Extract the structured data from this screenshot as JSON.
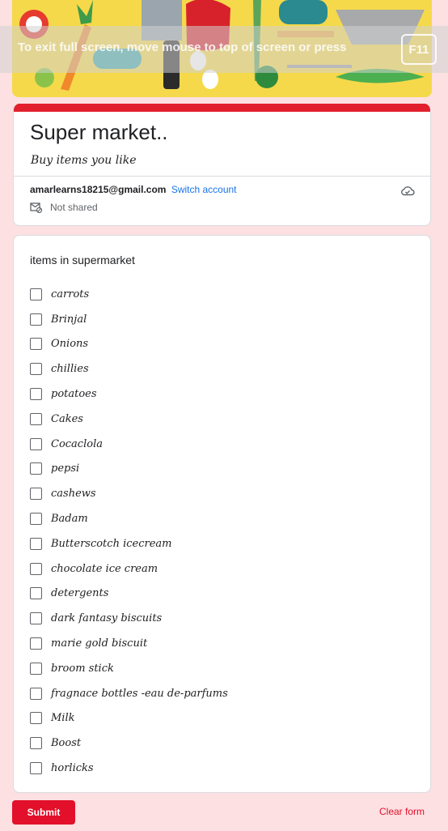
{
  "fullscreen_notice": {
    "text": "To exit full screen, move mouse to top of screen or press",
    "key": "F11"
  },
  "form": {
    "title": "Super market..",
    "description": "Buy items you  like",
    "account_email": "amarlearns18215@gmail.com",
    "switch_account": "Switch account",
    "share_status": "Not shared"
  },
  "question": {
    "title": "items in supermarket",
    "options": [
      "carrots",
      "Brinjal",
      "Onions",
      "chillies",
      "potatoes",
      "Cakes",
      "Cocaclola",
      "pepsi",
      "cashews",
      "Badam",
      "Butterscotch icecream",
      "chocolate ice cream",
      "detergents",
      "dark fantasy biscuits",
      "marie gold biscuit",
      "broom stick",
      "fragnace bottles -eau de-parfums",
      "Milk",
      "Boost",
      "horlicks"
    ]
  },
  "actions": {
    "submit": "Submit",
    "clear": "Clear form"
  },
  "colors": {
    "accent": "#e2202d",
    "background": "#fce0e2",
    "banner": "#f5d94a",
    "link": "#1a73e8"
  },
  "icons": [
    "cloud-save-icon",
    "not-shared-mail-icon"
  ]
}
